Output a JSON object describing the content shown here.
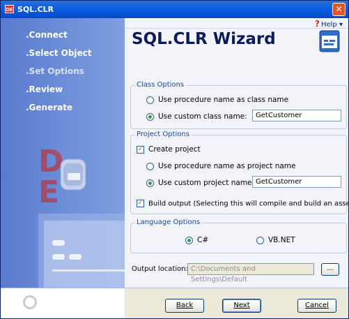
{
  "window": {
    "title": "SQL.CLR",
    "app_icon_text": "DE"
  },
  "sidebar": {
    "items": [
      {
        "label": ".Connect"
      },
      {
        "label": ".Select Object"
      },
      {
        "label": ".Set Options"
      },
      {
        "label": ".Review"
      },
      {
        "label": ".Generate"
      }
    ],
    "active_index": 2
  },
  "help": {
    "icon": "?",
    "label": "Help"
  },
  "heading": "SQL.CLR Wizard",
  "class_options": {
    "title": "Class Options",
    "opt_procedure": "Use procedure name as class name",
    "opt_custom": "Use custom class name:",
    "custom_value": "GetCustomer",
    "selected": "custom"
  },
  "project_options": {
    "title": "Project Options",
    "create_project": "Create project",
    "create_checked": true,
    "opt_procedure": "Use procedure name as project name",
    "opt_custom": "Use custom project name:",
    "custom_value": "GetCustomer",
    "selected": "custom",
    "build_output": "Build output (Selecting this will compile and build an assembly)",
    "build_checked": true
  },
  "language_options": {
    "title": "Language Options",
    "opt_cs": "C#",
    "opt_vb": "VB.NET",
    "selected": "C#"
  },
  "output": {
    "label": "Output location:",
    "value": "C:\\Documents and Settings\\Default",
    "browse_label": "..."
  },
  "buttons": {
    "back": "Back",
    "next": "Next",
    "cancel": "Cancel"
  },
  "colors": {
    "sidebar": "#6A8CD8",
    "accent_green": "#2FA12F",
    "heading": "#0B1A5A"
  }
}
